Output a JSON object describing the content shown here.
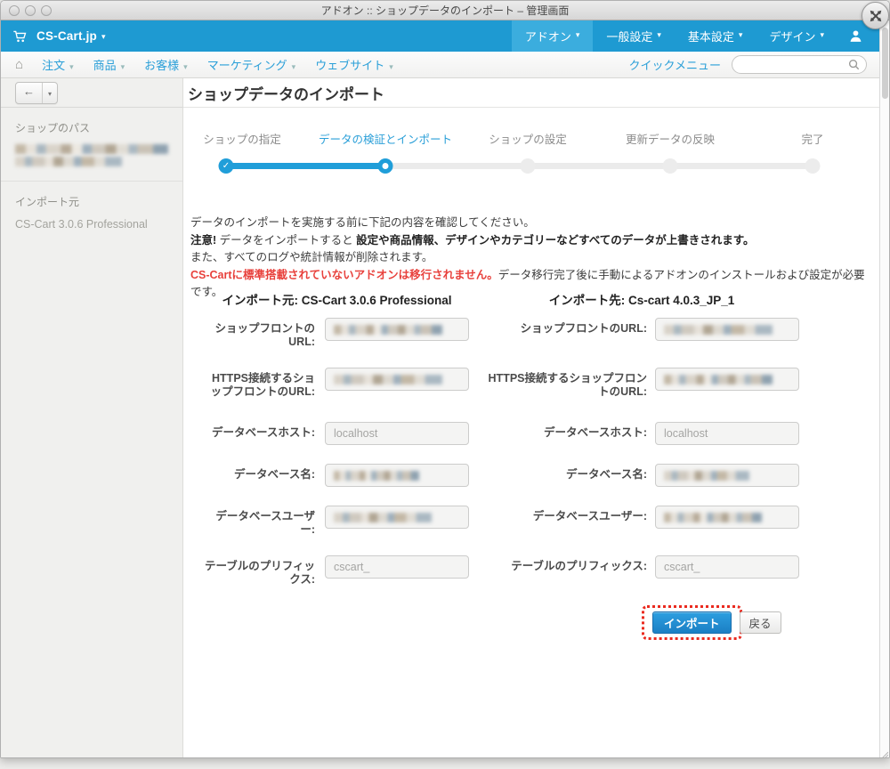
{
  "window": {
    "title": "アドオン :: ショップデータのインポート – 管理画面"
  },
  "navbar": {
    "brand": "CS-Cart.jp",
    "items": [
      {
        "label": "アドオン",
        "active": true
      },
      {
        "label": "一般設定",
        "active": false
      },
      {
        "label": "基本設定",
        "active": false
      },
      {
        "label": "デザイン",
        "active": false
      }
    ]
  },
  "subnav": {
    "items": [
      {
        "label": "注文"
      },
      {
        "label": "商品"
      },
      {
        "label": "お客様"
      },
      {
        "label": "マーケティング"
      },
      {
        "label": "ウェブサイト"
      }
    ],
    "quick_menu_label": "クイックメニュー",
    "search_placeholder": ""
  },
  "toolbar": {
    "back_label": "←",
    "back_caret": "▾"
  },
  "page": {
    "title": "ショップデータのインポート"
  },
  "sidebar": {
    "shop_path": {
      "label": "ショップのパス",
      "value_redacted": true
    },
    "import_source": {
      "label": "インポート元",
      "value": "CS-Cart 3.0.6 Professional"
    }
  },
  "wizard": {
    "steps": [
      {
        "label": "ショップの指定",
        "state": "done",
        "check": "✓"
      },
      {
        "label": "データの検証とインポート",
        "state": "current"
      },
      {
        "label": "ショップの設定",
        "state": "pending"
      },
      {
        "label": "更新データの反映",
        "state": "pending"
      },
      {
        "label": "完了",
        "state": "pending"
      }
    ]
  },
  "notice": {
    "line1": "データのインポートを実施する前に下記の内容を確認してください。",
    "line2_bold_prefix": "注意!",
    "line2_normal": " データをインポートすると ",
    "line2_bold": "設定や商品情報、デザインやカテゴリーなどすべてのデータが上書きされます。",
    "line3": "また、すべてのログや統計情報が削除されます。",
    "line4_red_bold": "CS-Cartに標準搭載されていないアドオンは移行されません。",
    "line4_normal": "データ移行完了後に手動によるアドオンのインストールおよび設定が必要です。"
  },
  "form": {
    "source": {
      "heading": "インポート元: CS-Cart 3.0.6 Professional",
      "fields": [
        {
          "label": "ショップフロントのURL:",
          "value": "",
          "redacted": true
        },
        {
          "label": "HTTPS接続するショップフロントのURL:",
          "value": "",
          "redacted": true
        },
        {
          "label": "データベースホスト:",
          "value": "localhost",
          "redacted": false
        },
        {
          "label": "データベース名:",
          "value": "",
          "redacted": true
        },
        {
          "label": "データベースユーザー:",
          "value": "",
          "redacted": true
        },
        {
          "label": "テーブルのプリフィックス:",
          "value": "cscart_",
          "redacted": false
        }
      ]
    },
    "target": {
      "heading": "インポート先: Cs-cart 4.0.3_JP_1",
      "fields": [
        {
          "label": "ショップフロントのURL:",
          "value": "",
          "redacted": true
        },
        {
          "label": "HTTPS接続するショップフロントのURL:",
          "value": "",
          "redacted": true
        },
        {
          "label": "データベースホスト:",
          "value": "localhost",
          "redacted": false
        },
        {
          "label": "データベース名:",
          "value": "",
          "redacted": true
        },
        {
          "label": "データベースユーザー:",
          "value": "",
          "redacted": true
        },
        {
          "label": "テーブルのプリフィックス:",
          "value": "cscart_",
          "redacted": false
        }
      ]
    },
    "buttons": {
      "import": "インポート",
      "back": "戻る"
    }
  },
  "colors": {
    "navbar_blue": "#1e9ad2",
    "active_item_blue": "#3badde",
    "link_blue": "#2a9fd8",
    "progress_blue": "#209ed9",
    "warning_red": "#e8413c",
    "annotation_red": "#ea2a1f",
    "primary_button_blue": "#1b7fc4"
  }
}
